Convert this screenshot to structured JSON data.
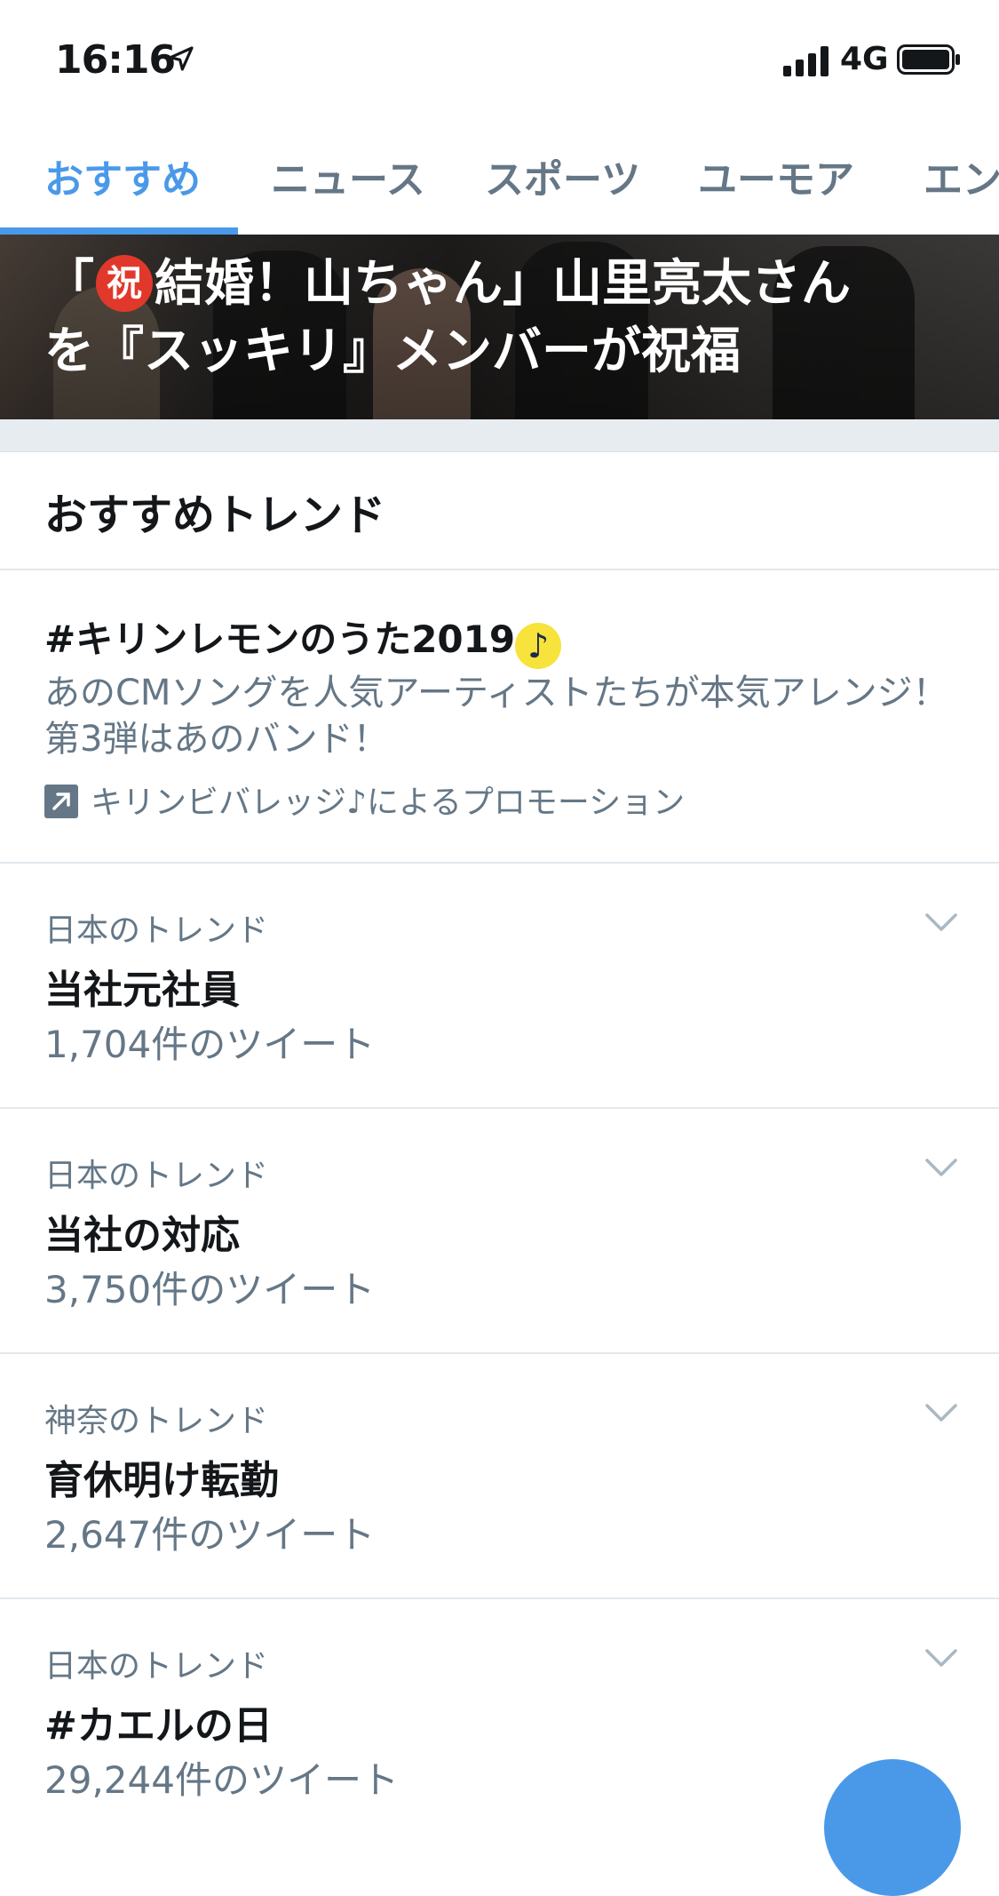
{
  "status_bar": {
    "time": "16:16",
    "network": "4G",
    "icons": [
      "location-arrow-icon",
      "signal-bars-icon",
      "battery-icon"
    ]
  },
  "tabs": [
    {
      "label": "おすすめ",
      "active": true
    },
    {
      "label": "ニュース",
      "active": false
    },
    {
      "label": "スポーツ",
      "active": false
    },
    {
      "label": "ユーモア",
      "active": false
    },
    {
      "label": "エン",
      "active": false
    }
  ],
  "hero": {
    "headline_line1_pre": "「",
    "headline_badge": "祝",
    "headline_line1_post": "結婚！山ちゃん」山里亮太さん",
    "headline_line2": "を『スッキリ』メンバーが祝福"
  },
  "section": {
    "title": "おすすめトレンド"
  },
  "promoted": {
    "hashtag": "#キリンレモンのうた2019",
    "hashtag_icon": "music-note-icon",
    "description": "あのCMソングを人気アーティストたちが本気アレンジ！第3弾はあのバンド！",
    "promoted_by": "キリンビバレッジ♪によるプロモーション"
  },
  "trends": [
    {
      "context": "日本のトレンド",
      "name": "当社元社員",
      "count": "1,704件のツイート"
    },
    {
      "context": "日本のトレンド",
      "name": "当社の対応",
      "count": "3,750件のツイート"
    },
    {
      "context": "神奈のトレンド",
      "name": "育休明け転勤",
      "count": "2,647件のツイート"
    },
    {
      "context": "日本のトレンド",
      "name": "#カエルの日",
      "count": "29,244件のツイート"
    }
  ],
  "colors": {
    "accent": "#4a99e9",
    "secondary_text": "#657786",
    "divider": "#e1e8ed"
  }
}
